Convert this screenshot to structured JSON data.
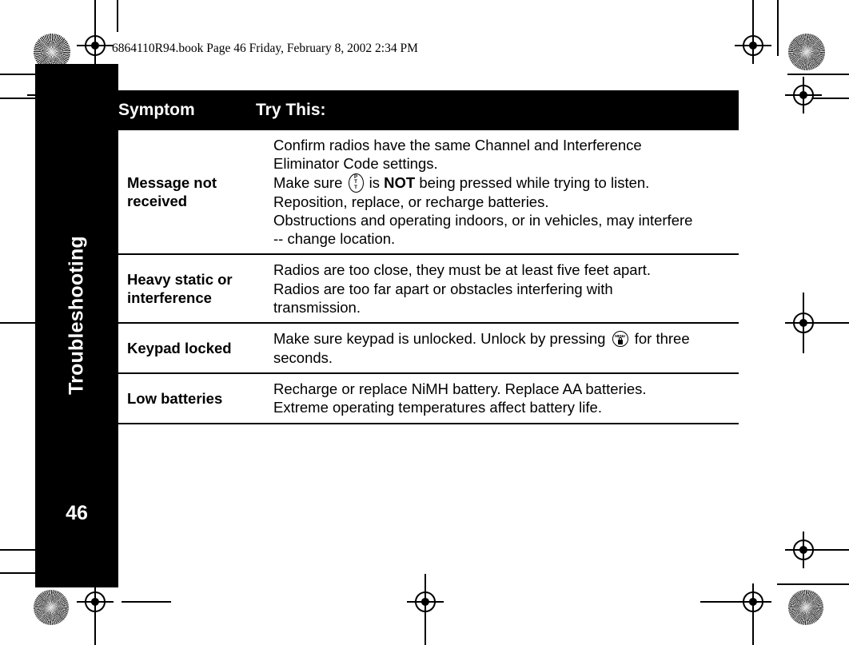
{
  "header": {
    "text": "6864110R94.book  Page 46  Friday, February 8, 2002  2:34 PM"
  },
  "sidebar": {
    "chapter_label": "Troubleshooting",
    "page_number": "46"
  },
  "table": {
    "columns": {
      "symptom": "Symptom",
      "try_this": "Try This:"
    },
    "rows": [
      {
        "symptom": "Message not received",
        "lines": [
          "Confirm radios have the same Channel and Interference Eliminator Code settings.",
          "Make sure [PTT] is NOT being pressed while trying to listen.",
          "Reposition, replace, or recharge batteries.",
          "Obstructions and operating indoors, or in vehicles, may interfere -- change location."
        ],
        "line1": "Confirm radios have the same Channel and Interference",
        "line2": "Eliminator Code settings.",
        "line3_a": "Make sure",
        "line3_b": "is",
        "line3_c": "NOT",
        "line3_d": "being pressed while trying to listen.",
        "line4": "Reposition, replace, or recharge batteries.",
        "line5": "Obstructions and operating indoors, or in vehicles, may interfere",
        "line6": "-- change location."
      },
      {
        "symptom": "Heavy static or interference",
        "line1": "Radios are too close, they must be at least five feet apart.",
        "line2": "Radios are too far apart or obstacles interfering with",
        "line3": "transmission."
      },
      {
        "symptom": "Keypad locked",
        "line1_a": "Make sure keypad is unlocked. Unlock by pressing",
        "line1_b": "for three",
        "line2": "seconds."
      },
      {
        "symptom": "Low batteries",
        "line1": "Recharge or replace NiMH battery. Replace AA batteries.",
        "line2": "Extreme operating temperatures affect battery life."
      }
    ]
  },
  "icons": {
    "ptt": {
      "name": "ptt-button-icon",
      "letters": [
        "P",
        "T",
        "T"
      ]
    },
    "menu": {
      "name": "menu-lock-button-icon",
      "label": "MENU"
    }
  },
  "colors": {
    "ink": "#000000",
    "paper": "#ffffff",
    "header_bar": "#000000",
    "header_text": "#ffffff"
  }
}
